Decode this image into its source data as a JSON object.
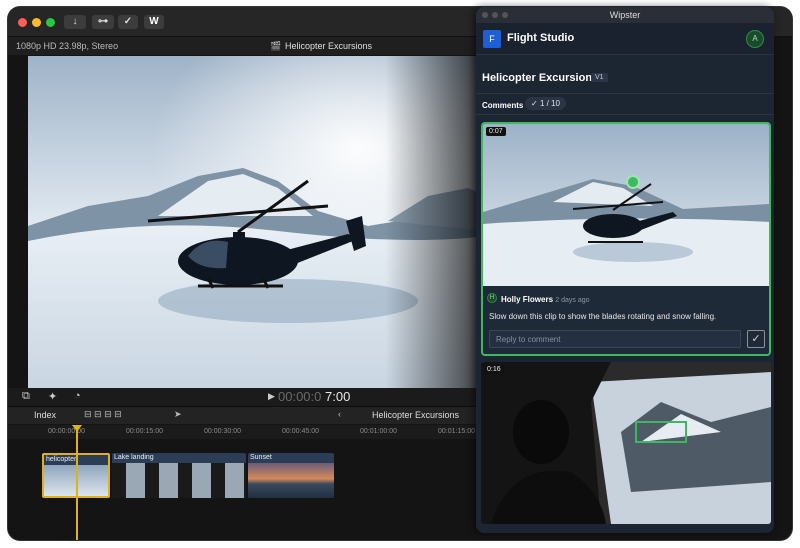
{
  "toolbar": {
    "import_label": "↓",
    "key_label": "⊶",
    "check_label": "✓",
    "wipster_label": "W"
  },
  "fcp": {
    "format": "1080p HD 23.98p, Stereo",
    "project_title": "Helicopter Excursions",
    "timecode_dim": "00:00:0",
    "timecode": "7:00"
  },
  "timeline": {
    "index_label": "Index",
    "project_label": "Helicopter Excursions",
    "ruler": [
      "00:00:00:00",
      "00:00:15:00",
      "00:00:30:00",
      "00:00:45:00",
      "00:01:00:00",
      "00:01:15:00"
    ],
    "clips": [
      {
        "label": "helicopter"
      },
      {
        "label": "Lake landing"
      },
      {
        "label": "Sunset"
      }
    ]
  },
  "wipster": {
    "window_title": "Wipster",
    "logo_letter": "F",
    "studio": "Flight Studio",
    "avatar_letter": "A",
    "project": "Helicopter Excursions",
    "version": "V1",
    "comments_label": "Comments",
    "comment_count": "1 / 10",
    "comment": {
      "time": "0:07",
      "author_initial": "H",
      "author": "Holly Flowers",
      "age": "2 days ago",
      "text": "Slow down this clip to show the blades rotating and snow falling.",
      "reply_placeholder": "Reply to comment"
    },
    "second_time": "0:16"
  },
  "colors": {
    "accent": "#3fb860",
    "playhead": "#e2b019",
    "clip": "#2b3e56"
  }
}
